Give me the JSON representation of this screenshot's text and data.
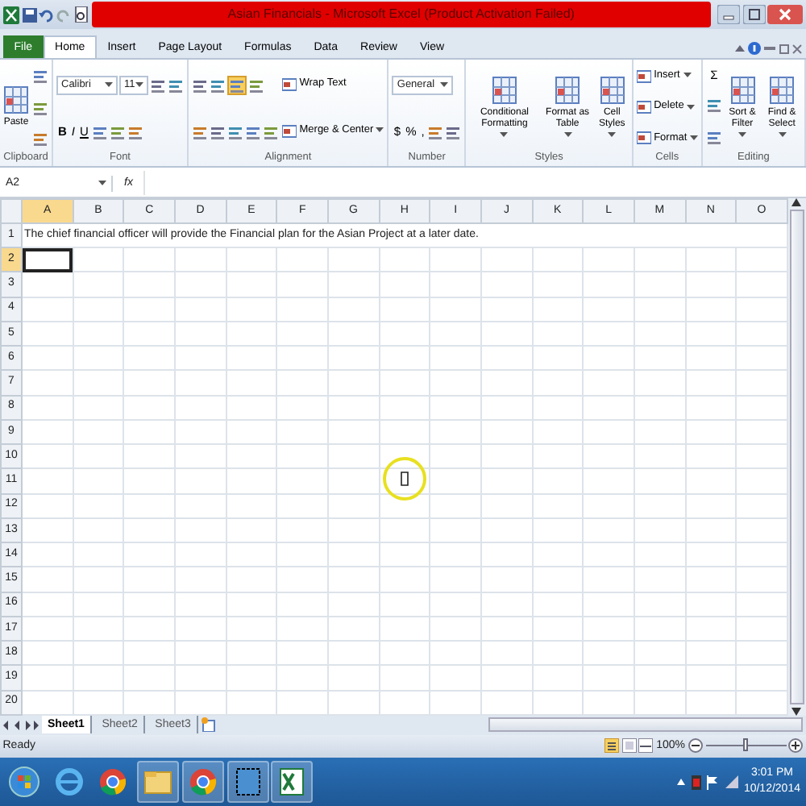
{
  "window": {
    "title": "Asian Financials - Microsoft Excel (Product Activation Failed)"
  },
  "tabs": [
    {
      "label": "File",
      "kind": "file",
      "selected": false
    },
    {
      "label": "Home",
      "kind": "tab",
      "selected": true
    },
    {
      "label": "Insert",
      "kind": "tab",
      "selected": false
    },
    {
      "label": "Page Layout",
      "kind": "tab",
      "selected": false
    },
    {
      "label": "Formulas",
      "kind": "tab",
      "selected": false
    },
    {
      "label": "Data",
      "kind": "tab",
      "selected": false
    },
    {
      "label": "Review",
      "kind": "tab",
      "selected": false
    },
    {
      "label": "View",
      "kind": "tab",
      "selected": false
    }
  ],
  "ribbon": {
    "groups": [
      {
        "label": "Clipboard",
        "columns": [
          [
            {
              "kind": "large",
              "label": "Paste"
            }
          ],
          [
            {
              "kind": "icon"
            },
            {
              "kind": "icon"
            },
            {
              "kind": "icon"
            }
          ]
        ]
      },
      {
        "label": "Font",
        "columns": [
          [
            {
              "kind": "row",
              "items": [
                {
                  "kind": "widecombo",
                  "label": "Calibri"
                },
                {
                  "kind": "combo",
                  "label": "11"
                },
                {
                  "kind": "icon"
                },
                {
                  "kind": "icon"
                }
              ]
            },
            {
              "kind": "row",
              "items": [
                {
                  "kind": "glyph",
                  "label": "B"
                },
                {
                  "kind": "glyph",
                  "label": "I"
                },
                {
                  "kind": "glyph",
                  "label": "U"
                },
                {
                  "kind": "icon"
                },
                {
                  "kind": "icon"
                },
                {
                  "kind": "icon"
                }
              ]
            }
          ]
        ]
      },
      {
        "label": "Alignment",
        "columns": [
          [
            {
              "kind": "row",
              "items": [
                {
                  "kind": "icon",
                  "selected": false
                },
                {
                  "kind": "icon",
                  "selected": false
                },
                {
                  "kind": "icon",
                  "selected": true
                },
                {
                  "kind": "icon"
                }
              ]
            },
            {
              "kind": "row",
              "items": [
                {
                  "kind": "icon"
                },
                {
                  "kind": "icon"
                },
                {
                  "kind": "icon"
                },
                {
                  "kind": "icon"
                },
                {
                  "kind": "icon"
                }
              ]
            }
          ],
          [
            {
              "kind": "small",
              "label": "Wrap Text"
            },
            {
              "kind": "smallmenu",
              "label": "Merge & Center"
            }
          ]
        ]
      },
      {
        "label": "Number",
        "columns": [
          [
            {
              "kind": "widecombo",
              "label": "General"
            },
            {
              "kind": "row",
              "items": [
                {
                  "kind": "glyph",
                  "label": "$"
                },
                {
                  "kind": "glyph",
                  "label": "%"
                },
                {
                  "kind": "glyph",
                  "label": ","
                },
                {
                  "kind": "icon"
                },
                {
                  "kind": "icon"
                }
              ]
            }
          ]
        ]
      },
      {
        "label": "Styles",
        "columns": [
          [
            {
              "kind": "largemenu",
              "label": "Conditional Formatting"
            }
          ],
          [
            {
              "kind": "largemenu",
              "label": "Format as Table"
            }
          ],
          [
            {
              "kind": "largemenu",
              "label": "Cell Styles"
            }
          ]
        ]
      },
      {
        "label": "Cells",
        "columns": [
          [
            {
              "kind": "smallmenu",
              "label": "Insert"
            },
            {
              "kind": "smallmenu",
              "label": "Delete"
            },
            {
              "kind": "smallmenu",
              "label": "Format"
            }
          ]
        ]
      },
      {
        "label": "Editing",
        "columns": [
          [
            {
              "kind": "glyph",
              "label": "Σ"
            },
            {
              "kind": "icon"
            },
            {
              "kind": "icon"
            }
          ],
          [
            {
              "kind": "largemenu",
              "label": "Sort & Filter"
            }
          ],
          [
            {
              "kind": "largemenu",
              "label": "Find & Select"
            }
          ]
        ]
      }
    ]
  },
  "formula_bar": {
    "name_box": "A2",
    "function_label": "fx"
  },
  "sheet": {
    "columns": [
      {
        "label": "A",
        "selected": true
      },
      {
        "label": "B",
        "selected": false
      },
      {
        "label": "C",
        "selected": false
      },
      {
        "label": "D",
        "selected": false
      },
      {
        "label": "E",
        "selected": false
      },
      {
        "label": "F",
        "selected": false
      },
      {
        "label": "G",
        "selected": false
      },
      {
        "label": "H",
        "selected": false
      },
      {
        "label": "I",
        "selected": false
      },
      {
        "label": "J",
        "selected": false
      },
      {
        "label": "K",
        "selected": false
      },
      {
        "label": "L",
        "selected": false
      },
      {
        "label": "M",
        "selected": false
      },
      {
        "label": "N",
        "selected": false
      },
      {
        "label": "O",
        "selected": false
      }
    ],
    "rows": [
      {
        "label": "1",
        "selected": false,
        "text": "The chief financial officer will provide the Financial plan for the Asian Project at a later date."
      },
      {
        "label": "2",
        "selected": true
      },
      {
        "label": "3",
        "selected": false
      },
      {
        "label": "4",
        "selected": false
      },
      {
        "label": "5",
        "selected": false
      },
      {
        "label": "6",
        "selected": false
      },
      {
        "label": "7",
        "selected": false
      },
      {
        "label": "8",
        "selected": false
      },
      {
        "label": "9",
        "selected": false
      },
      {
        "label": "10",
        "selected": false
      },
      {
        "label": "11",
        "selected": false
      },
      {
        "label": "12",
        "selected": false
      },
      {
        "label": "13",
        "selected": false
      },
      {
        "label": "14",
        "selected": false
      },
      {
        "label": "15",
        "selected": false
      },
      {
        "label": "16",
        "selected": false
      },
      {
        "label": "17",
        "selected": false
      },
      {
        "label": "18",
        "selected": false
      },
      {
        "label": "19",
        "selected": false
      },
      {
        "label": "20",
        "selected": false
      }
    ]
  },
  "sheet_tabs": [
    {
      "label": "Sheet1",
      "selected": true
    },
    {
      "label": "Sheet2",
      "selected": false
    },
    {
      "label": "Sheet3",
      "selected": false
    }
  ],
  "status_bar": {
    "status": "Ready",
    "zoom": "100%",
    "level": 0.5
  },
  "taskbar": {
    "time": "3:01 PM",
    "date": "10/12/2014"
  }
}
